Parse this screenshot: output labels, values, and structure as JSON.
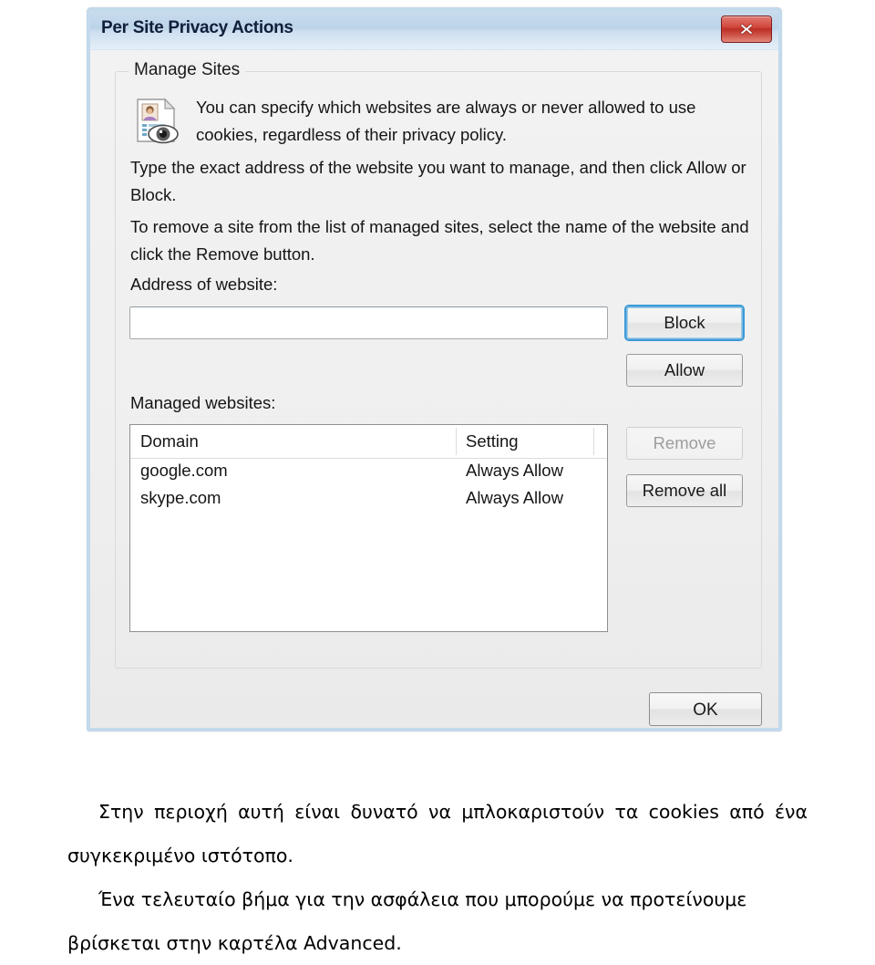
{
  "window": {
    "title": "Per Site Privacy Actions",
    "close_icon": "close-icon"
  },
  "groupbox": {
    "legend": "Manage Sites",
    "icon": "privacy-document-eye-icon",
    "info_text": "You can specify which websites are always or never allowed to use cookies, regardless of their privacy policy.",
    "type_text": "Type the exact address of the website you want to manage, and then click Allow or Block.",
    "remove_text": "To remove a site from the list of managed sites, select the name of the website and click the Remove button."
  },
  "address": {
    "label": "Address of website:",
    "value": "",
    "placeholder": ""
  },
  "buttons": {
    "block": "Block",
    "allow": "Allow",
    "remove": "Remove",
    "remove_all": "Remove all",
    "ok": "OK"
  },
  "managed": {
    "label": "Managed websites:",
    "columns": [
      "Domain",
      "Setting"
    ],
    "rows": [
      {
        "domain": "google.com",
        "setting": "Always Allow"
      },
      {
        "domain": "skype.com",
        "setting": "Always Allow"
      }
    ]
  },
  "caption": {
    "paragraph1": "Στην περιοχή αυτή είναι δυνατό να μπλοκαριστούν τα cookies από ένα συγκεκριμένο ιστότοπο.",
    "paragraph2": "Ένα τελευταίο βήμα για την ασφάλεια που μπορούμε να προτείνουμε βρίσκεται στην καρτέλα Advanced."
  },
  "colors": {
    "titlebar": "#bcd3e8",
    "close_button": "#c8362c",
    "focus_ring": "#3c9ad8",
    "dialog_bg": "#f0f0f0",
    "window_border": "#c3d9ec"
  }
}
